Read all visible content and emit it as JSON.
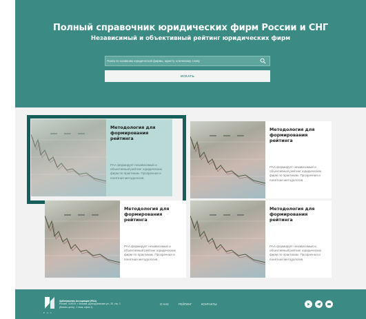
{
  "hero": {
    "title": "Полный справочник юридических фирм России и СНГ",
    "subtitle": "Независимый и объективный рейтинг юридических фирм",
    "search": {
      "placeholder": "Поиск по названию юридической фирмы, юристу, ключевому слову",
      "button_label": "ИСКАТЬ"
    }
  },
  "cards": [
    {
      "title": "Методология для формирования рейтинга",
      "text": "РАА формирует независимый и объективный рейтинг юридических фирм по практикам. Прозрачная и понятная методология.",
      "active": true
    },
    {
      "title": "Методология для формирования рейтинга",
      "text": "РАА формирует независимый и объективный рейтинг юридических фирм по практикам. Прозрачная и понятная методология.",
      "active": false
    },
    {
      "title": "Методология для формирования рейтинга",
      "text": "РАА формирует независимый и объективный рейтинг юридических фирм по практикам. Прозрачная и понятная методология.",
      "active": false
    },
    {
      "title": "Методология для формирования рейтинга",
      "text": "РАА формирует независимый и объективный рейтинг юридических фирм по практикам. Прозрачная и понятная методология.",
      "active": false
    }
  ],
  "footer": {
    "logo_caption": "Р А А",
    "org_name": "Арбитражная Ассоциация (РАА)",
    "org_address": "Россия, 119019, г. Москва, Долгоруковская ул., 20, стр. 1 (бизнес-центр, 1 этаж, офис 1)",
    "nav": [
      "О НАС",
      "РЕЙТИНГ",
      "КОНТАКТЫ"
    ],
    "social": [
      "youtube-icon",
      "telegram-icon",
      "vk-icon"
    ]
  },
  "colors": {
    "brand": "#3b8b84",
    "active_outline": "#145f5a",
    "page_bg": "#f1f2f1"
  }
}
